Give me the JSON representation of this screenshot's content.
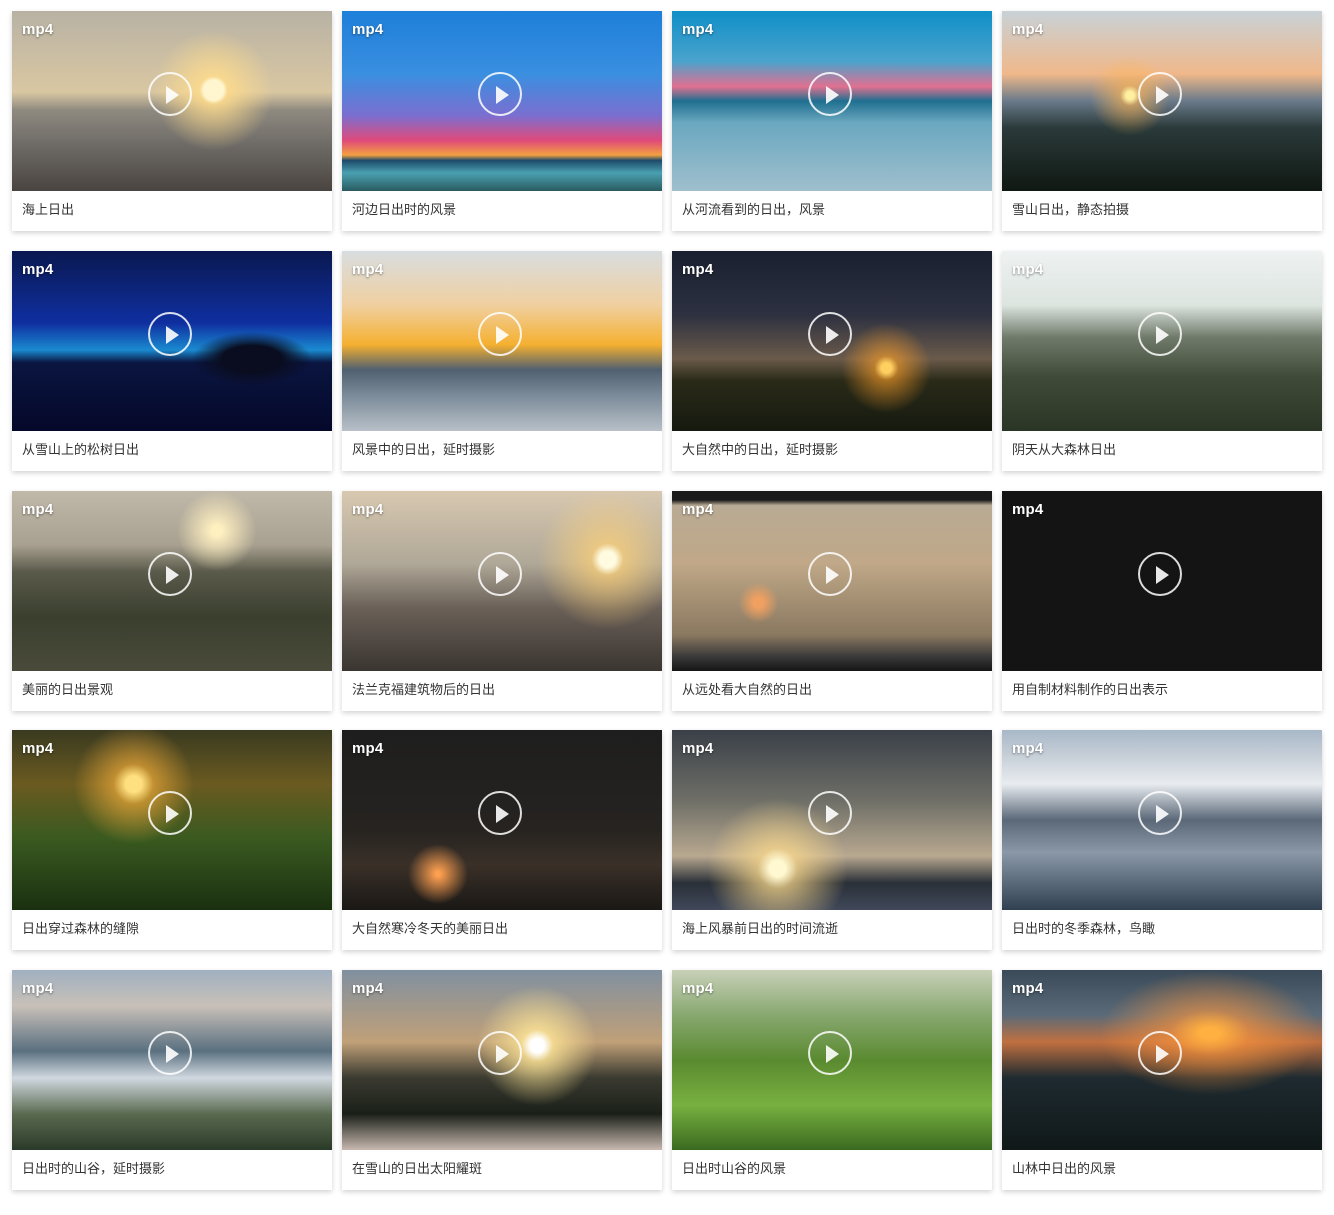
{
  "badge_text": "mp4",
  "videos": [
    {
      "title": "海上日出"
    },
    {
      "title": "河边日出时的风景"
    },
    {
      "title": "从河流看到的日出，风景"
    },
    {
      "title": "雪山日出，静态拍摄"
    },
    {
      "title": "从雪山上的松树日出"
    },
    {
      "title": "风景中的日出，延时摄影"
    },
    {
      "title": "大自然中的日出，延时摄影"
    },
    {
      "title": "阴天从大森林日出"
    },
    {
      "title": "美丽的日出景观"
    },
    {
      "title": "法兰克福建筑物后的日出"
    },
    {
      "title": "从远处看大自然的日出"
    },
    {
      "title": "用自制材料制作的日出表示"
    },
    {
      "title": "日出穿过森林的缝隙"
    },
    {
      "title": "大自然寒冷冬天的美丽日出"
    },
    {
      "title": "海上风暴前日出的时间流逝"
    },
    {
      "title": "日出时的冬季森林，鸟瞰"
    },
    {
      "title": "日出时的山谷，延时摄影"
    },
    {
      "title": "在雪山的日出太阳耀斑"
    },
    {
      "title": "日出时山谷的风景"
    },
    {
      "title": "山林中日出的风景"
    }
  ]
}
